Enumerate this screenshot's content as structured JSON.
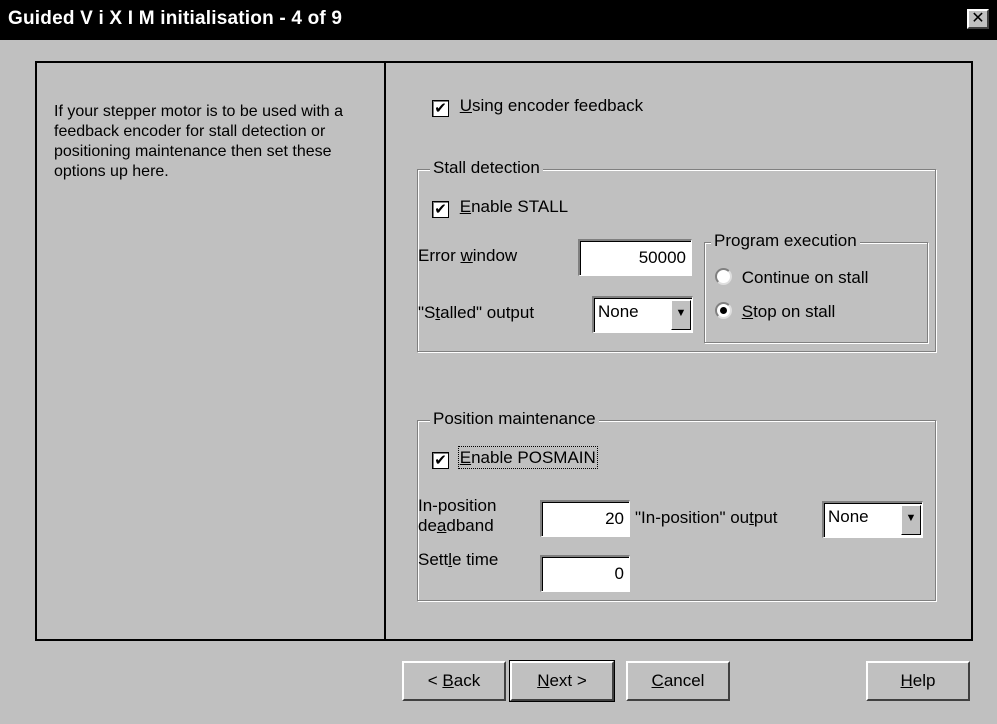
{
  "window": {
    "title": "Guided V i X I M initialisation - 4 of 9",
    "close_glyph": "✕"
  },
  "left_text": "If your stepper motor is to be used with a feedback encoder for stall detection or positioning maintenance then set these options up here.",
  "encoder": {
    "checked": true,
    "label_mnemonic": "U",
    "label_rest": "sing encoder feedback"
  },
  "stall": {
    "group_label": "Stall detection",
    "enable": {
      "checked": true,
      "label_mnemonic": "E",
      "label_rest": "nable STALL"
    },
    "error_window": {
      "label_pre": "Error ",
      "label_mnemonic": "w",
      "label_post": "indow",
      "value": "50000"
    },
    "stalled_output": {
      "label_pre": "\"S",
      "label_mnemonic": "t",
      "label_post": "alled\" output",
      "value": "None"
    },
    "program_execution": {
      "group_label": "Program execution",
      "options": [
        {
          "label": "Continue on stall",
          "selected": false
        },
        {
          "label_mnemonic": "S",
          "label_rest": "top on stall",
          "selected": true
        }
      ]
    }
  },
  "posmain": {
    "group_label": "Position maintenance",
    "enable": {
      "checked": true,
      "label_mnemonic": "E",
      "label_rest": "nable POSMAIN"
    },
    "deadband": {
      "label_line1": "In-position",
      "label_pre": "de",
      "label_mnemonic": "a",
      "label_post": "dband",
      "value": "20"
    },
    "inpos_output": {
      "label_pre": "\"In-position\" ou",
      "label_mnemonic": "t",
      "label_post": "put",
      "value": "None"
    },
    "settle": {
      "label_pre": "Sett",
      "label_mnemonic": "l",
      "label_post": "e time",
      "value": "0"
    }
  },
  "buttons": {
    "back": {
      "pre": "< ",
      "mnemonic": "B",
      "rest": "ack"
    },
    "next": {
      "mnemonic": "N",
      "rest": "ext >"
    },
    "cancel": {
      "mnemonic": "C",
      "rest": "ancel"
    },
    "help": {
      "mnemonic": "H",
      "rest": "elp"
    }
  },
  "icons": {
    "checkmark": "✔",
    "dropdown_arrow": "▼"
  }
}
